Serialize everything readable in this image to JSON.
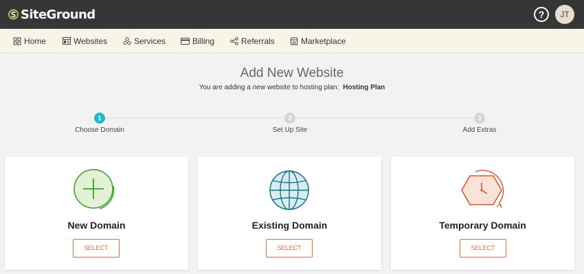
{
  "topbar": {
    "logo_text": "SiteGround",
    "help_label": "?",
    "avatar_initials": "JT"
  },
  "nav": {
    "items": [
      {
        "label": "Home",
        "icon": "grid-icon"
      },
      {
        "label": "Websites",
        "icon": "browser-icon"
      },
      {
        "label": "Services",
        "icon": "services-icon"
      },
      {
        "label": "Billing",
        "icon": "credit-card-icon"
      },
      {
        "label": "Referrals",
        "icon": "share-icon"
      },
      {
        "label": "Marketplace",
        "icon": "store-icon"
      }
    ]
  },
  "page": {
    "title": "Add New Website",
    "subtitle_prefix": "You are adding a new website to hosting plan:",
    "plan_name": "Hosting Plan"
  },
  "steps": [
    {
      "number": "1",
      "label": "Choose Domain",
      "active": true
    },
    {
      "number": "2",
      "label": "Set Up Site",
      "active": false
    },
    {
      "number": "3",
      "label": "Add Extras",
      "active": false
    }
  ],
  "cards": [
    {
      "title": "New Domain",
      "button": "SELECT",
      "icon": "plus-circle-icon",
      "color": "#3d9a2e"
    },
    {
      "title": "Existing Domain",
      "button": "SELECT",
      "icon": "globe-icon",
      "color": "#1d6f86"
    },
    {
      "title": "Temporary Domain",
      "button": "SELECT",
      "icon": "clock-icon",
      "color": "#d2552b"
    }
  ],
  "colors": {
    "topbar": "#363636",
    "navbar": "#f6f5e8",
    "accent": "#e86a3a",
    "step_active": "#22b8cf"
  }
}
